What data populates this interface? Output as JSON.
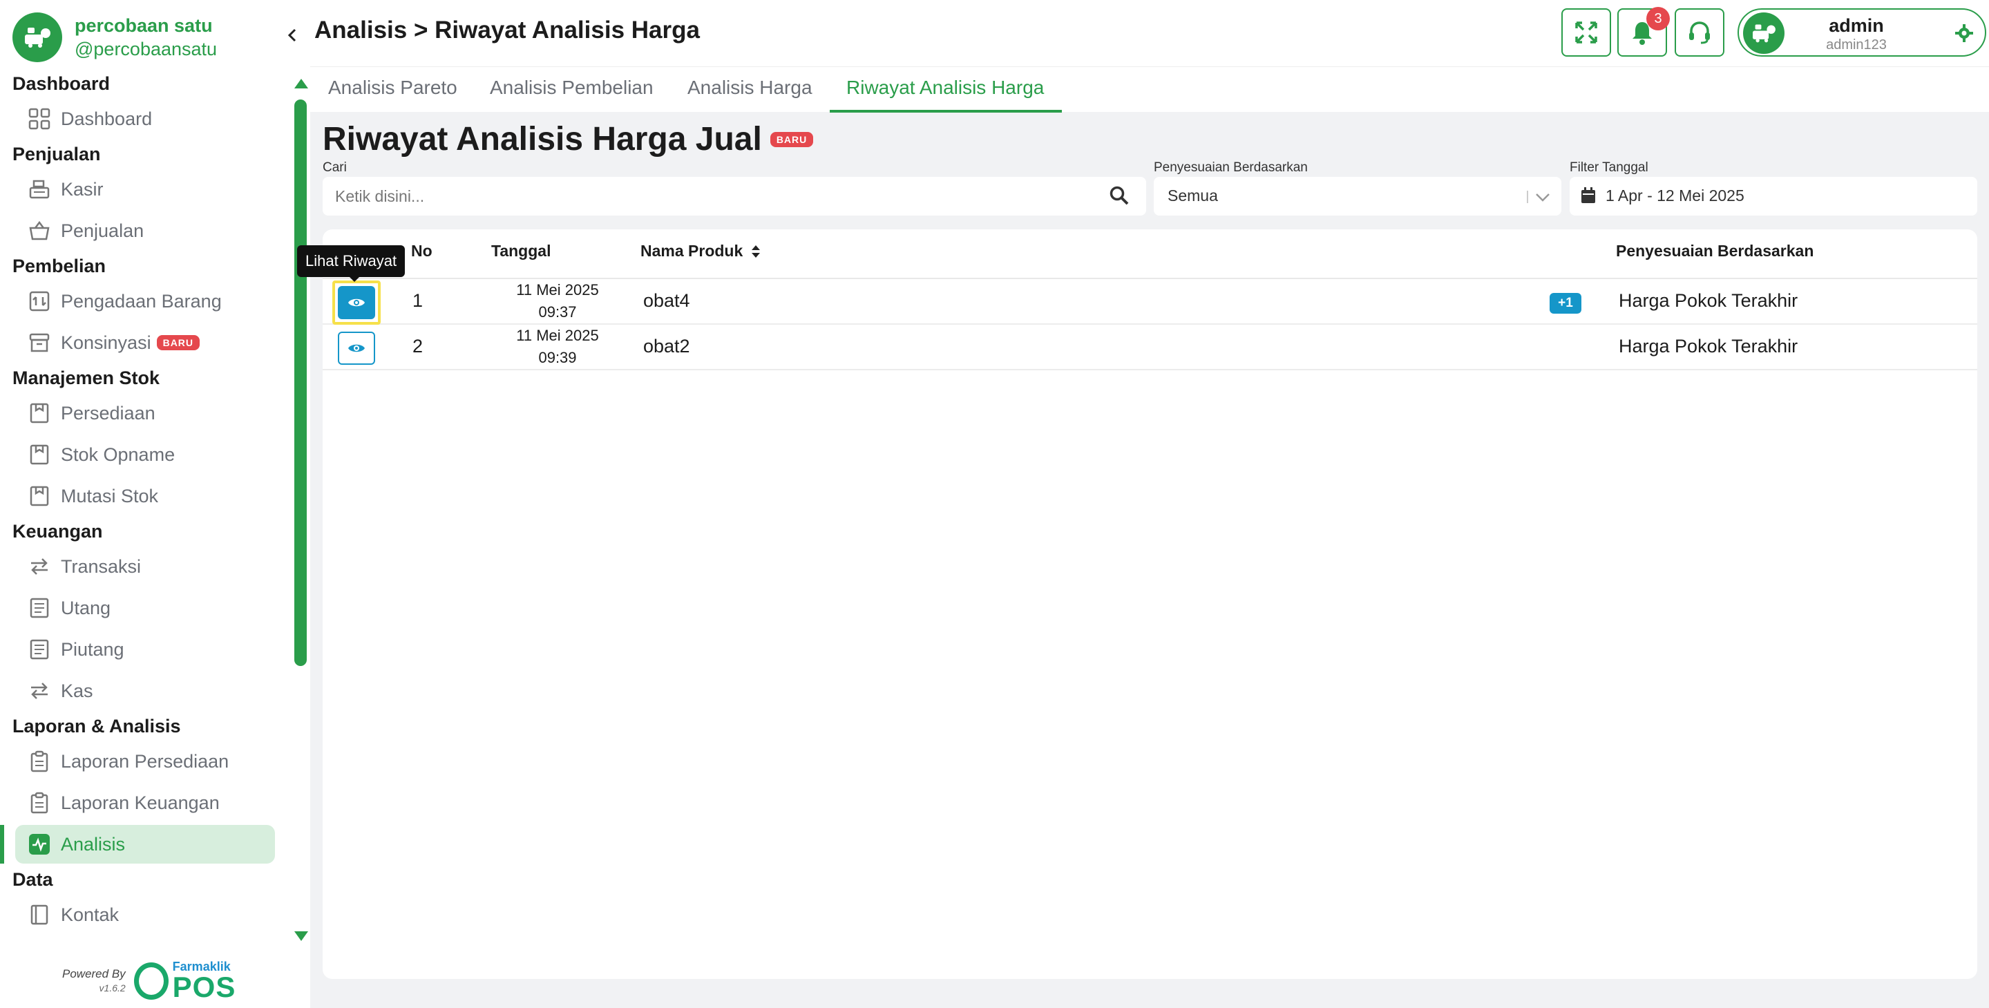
{
  "brand": {
    "name": "percobaan satu",
    "handle": "@percobaansatu"
  },
  "sidebar": {
    "sections": [
      {
        "title": "Dashboard",
        "items": [
          {
            "label": "Dashboard",
            "icon": "grid-icon"
          }
        ]
      },
      {
        "title": "Penjualan",
        "items": [
          {
            "label": "Kasir",
            "icon": "cash-register-icon"
          },
          {
            "label": "Penjualan",
            "icon": "basket-icon"
          }
        ]
      },
      {
        "title": "Pembelian",
        "items": [
          {
            "label": "Pengadaan Barang",
            "icon": "procurement-icon"
          },
          {
            "label": "Konsinyasi",
            "icon": "archive-box-icon",
            "badge": "BARU"
          }
        ]
      },
      {
        "title": "Manajemen Stok",
        "items": [
          {
            "label": "Persediaan",
            "icon": "inventory-icon"
          },
          {
            "label": "Stok Opname",
            "icon": "stock-opname-icon"
          },
          {
            "label": "Mutasi Stok",
            "icon": "stock-mutation-icon"
          }
        ]
      },
      {
        "title": "Keuangan",
        "items": [
          {
            "label": "Transaksi",
            "icon": "transfer-arrows-icon"
          },
          {
            "label": "Utang",
            "icon": "receipt-icon"
          },
          {
            "label": "Piutang",
            "icon": "receipt-icon"
          },
          {
            "label": "Kas",
            "icon": "transfer-arrows-icon"
          }
        ]
      },
      {
        "title": "Laporan & Analisis",
        "items": [
          {
            "label": "Laporan Persediaan",
            "icon": "clipboard-icon"
          },
          {
            "label": "Laporan Keuangan",
            "icon": "clipboard-icon"
          },
          {
            "label": "Analisis",
            "icon": "pulse-chart-icon",
            "active": true
          }
        ]
      },
      {
        "title": "Data",
        "items": [
          {
            "label": "Kontak",
            "icon": "contact-book-icon"
          }
        ]
      }
    ],
    "powered_by": "Powered By",
    "version": "v1.6.2",
    "pos_brand_top": "Farmaklik",
    "pos_brand_main": "POS"
  },
  "header": {
    "breadcrumb": "Analisis > Riwayat Analisis Harga",
    "notification_count": "3",
    "user_name": "admin",
    "user_sub": "admin123"
  },
  "tabs": [
    {
      "label": "Analisis Pareto"
    },
    {
      "label": "Analisis Pembelian"
    },
    {
      "label": "Analisis Harga"
    },
    {
      "label": "Riwayat Analisis Harga",
      "active": true
    }
  ],
  "main": {
    "title": "Riwayat Analisis Harga Jual",
    "title_badge": "BARU",
    "search_label": "Cari",
    "search_placeholder": "Ketik disini...",
    "adjust_label": "Penyesuaian Berdasarkan",
    "adjust_value": "Semua",
    "date_label": "Filter Tanggal",
    "date_value": "1 Apr - 12 Mei 2025"
  },
  "table": {
    "columns": [
      "No",
      "Tanggal",
      "Nama Produk",
      "Penyesuaian Berdasarkan"
    ],
    "rows": [
      {
        "no": "1",
        "date": "11 Mei 2025",
        "time": "09:37",
        "product": "obat4",
        "extra": "+1",
        "adjustment": "Harga Pokok Terakhir"
      },
      {
        "no": "2",
        "date": "11 Mei 2025",
        "time": "09:39",
        "product": "obat2",
        "adjustment": "Harga Pokok Terakhir"
      }
    ]
  },
  "tooltip": "Lihat Riwayat",
  "colors": {
    "primary": "#2a9d4a",
    "action_blue": "#1596c9",
    "badge_red": "#e5484d",
    "highlight": "#f6e04a"
  }
}
